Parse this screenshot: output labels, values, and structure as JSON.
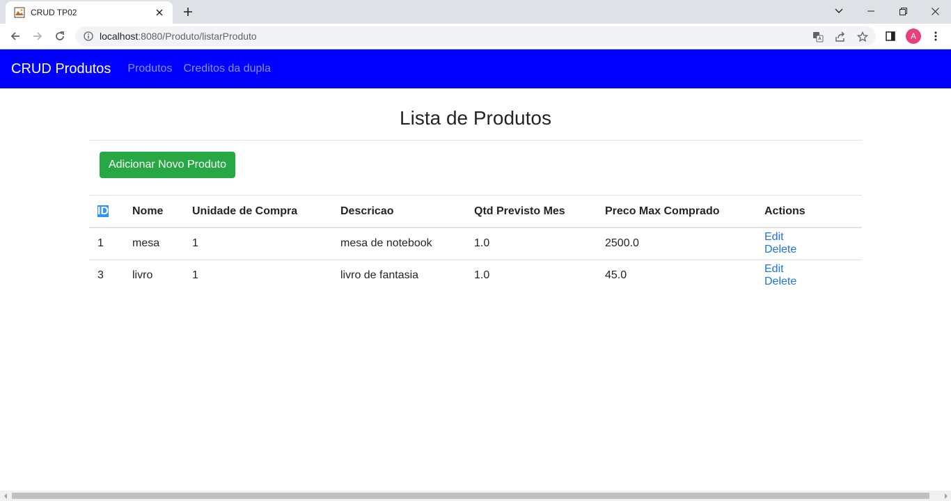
{
  "browser": {
    "tab_title": "CRUD TP02",
    "url_host": "localhost",
    "url_rest": ":8080/Produto/listarProduto",
    "avatar_letter": "A"
  },
  "navbar": {
    "brand": "CRUD Produtos",
    "links": [
      "Produtos",
      "Creditos da dupla"
    ]
  },
  "page": {
    "title": "Lista de Produtos",
    "add_button": "Adicionar Novo Produto"
  },
  "table": {
    "headers": [
      "ID",
      "Nome",
      "Unidade de Compra",
      "Descricao",
      "Qtd Previsto Mes",
      "Preco Max Comprado",
      "Actions"
    ],
    "rows": [
      {
        "id": "1",
        "nome": "mesa",
        "unidade": "1",
        "descricao": "mesa de notebook",
        "qtd": "1.0",
        "preco": "2500.0",
        "edit": "Edit",
        "delete": "Delete"
      },
      {
        "id": "3",
        "nome": "livro",
        "unidade": "1",
        "descricao": "livro de fantasia",
        "qtd": "1.0",
        "preco": "45.0",
        "edit": "Edit",
        "delete": "Delete"
      }
    ]
  },
  "colors": {
    "navbar_bg": "#0000ff",
    "add_button_bg": "#28a745",
    "link": "#1a73e8"
  }
}
